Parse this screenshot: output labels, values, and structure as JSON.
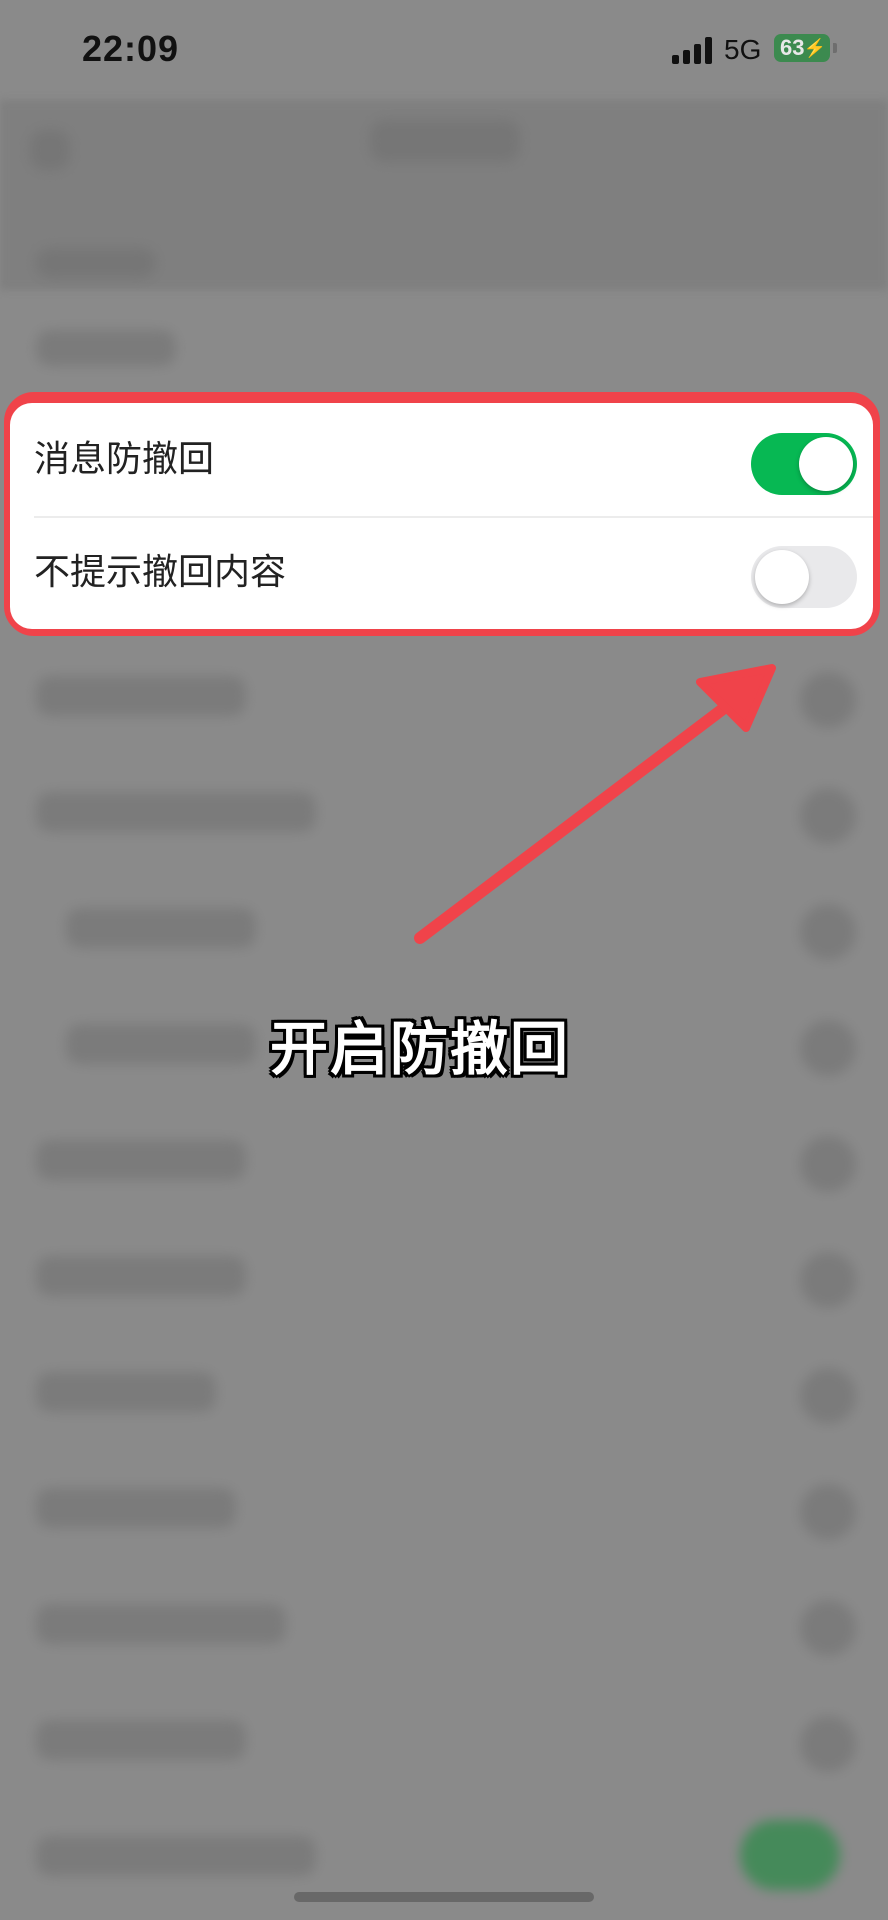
{
  "status_bar": {
    "time": "22:09",
    "network": "5G",
    "battery": "63"
  },
  "settings": {
    "items": [
      {
        "label": "消息防撤回",
        "enabled": true
      },
      {
        "label": "不提示撤回内容",
        "enabled": false
      }
    ]
  },
  "annotation": {
    "caption": "开启防撤回",
    "highlight_color": "#f0434a"
  },
  "colors": {
    "toggle_on": "#07b853",
    "toggle_off": "#e9e9eb",
    "overlay": "#8a8a8a"
  },
  "icons": [
    "signal-icon",
    "battery-icon",
    "charging-bolt-icon",
    "arrow-icon"
  ]
}
